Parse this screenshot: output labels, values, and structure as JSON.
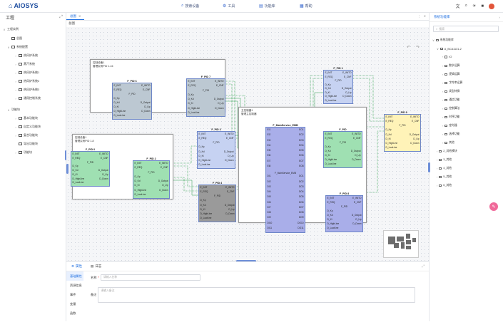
{
  "header": {
    "logo": "AIOSYS",
    "nav": [
      {
        "label": "搜索设备",
        "icon": "search-icon"
      },
      {
        "label": "工具",
        "icon": "tools-icon"
      },
      {
        "label": "功能库",
        "icon": "library-icon"
      },
      {
        "label": "帮助",
        "icon": "help-icon"
      }
    ]
  },
  "left_panel": {
    "title": "工程",
    "tree": [
      {
        "label": "工程实例"
      },
      {
        "label": "总图"
      },
      {
        "label": "系统配置"
      },
      {
        "label": "热风炉系统"
      },
      {
        "label": "蒸汽系统"
      },
      {
        "label": "热风炉系统1"
      },
      {
        "label": "热风炉系统2"
      },
      {
        "label": "热风炉系统3"
      },
      {
        "label": "通用控制系统"
      },
      {
        "label": "功能块"
      },
      {
        "label": "基本功能块"
      },
      {
        "label": "自定义功能块"
      },
      {
        "label": "复合功能块"
      },
      {
        "label": "导出功能块"
      },
      {
        "label": "功能块"
      }
    ]
  },
  "tabs": [
    {
      "label": "总图",
      "active": true
    }
  ],
  "breadcrumb": "总图",
  "canvas": {
    "groups": [
      {
        "title": "控制设备1",
        "subtitle": "管理实例PID 1-16"
      },
      {
        "title": "控制设备1",
        "subtitle": "管理实例PID 1-8"
      },
      {
        "title": "主控制器1",
        "subtitle": "管理主控制器"
      }
    ],
    "blocks": {
      "fpid6": {
        "title": "F_PID 6",
        "left": [
          "E_INIT",
          "E_REQ",
          "",
          "D_Kp",
          "D_Kd",
          "D_Ki",
          "D_HighLine",
          "D_LowLine"
        ],
        "right": [
          "E_INITO",
          "E_CNF",
          "",
          "",
          "D_Output",
          "D_Up",
          "D_Down",
          ""
        ],
        "center": "F_PID"
      },
      "fpid7": {
        "title": "F_PID 7",
        "left": [
          "E_INIT",
          "E_REQ",
          "",
          "D_Kp",
          "D_Kd",
          "D_Ki",
          "D_HighLine",
          "D_LowLine"
        ],
        "right": [
          "E_INITO",
          "E_CNF",
          "",
          "",
          "D_Output",
          "D_Up",
          "D_Down",
          ""
        ],
        "center": "F_PID"
      },
      "fpid1": {
        "title": "F_PID 1",
        "left": [
          "E_INIT",
          "E_REQ",
          "",
          "D_Kp",
          "D_Kd",
          "D_Ki",
          "D_HighLine",
          "D_LowLine"
        ],
        "right": [
          "E_INITO",
          "E_CNF",
          "",
          "",
          "D_Output",
          "D_Up",
          "D_Down",
          ""
        ],
        "center": "F_PID"
      },
      "fpid3": {
        "title": "F_PID 3",
        "left": [
          "E_INIT",
          "E_REQ",
          "",
          "D_Kp",
          "D_Kd",
          "D_Ki",
          "D_HighLine",
          "D_LowLine"
        ],
        "right": [
          "E_INITO",
          "E_CNF",
          "",
          "",
          "D_Output",
          "D_Up",
          "D_Down",
          ""
        ],
        "center": "F_PID"
      },
      "fpid2": {
        "title": "F_PID 2",
        "left": [
          "E_INIT",
          "E_REQ",
          "",
          "D_Kp",
          "D_Kd",
          "D_Ki",
          "D_HighLine",
          "D_LowLine"
        ],
        "right": [
          "E_INITO",
          "E_CNF",
          "",
          "",
          "D_Output",
          "D_Up",
          "D_Down",
          ""
        ],
        "center": "F_PID"
      },
      "fpid0": {
        "title": "F_PID 0",
        "left": [
          "E_INIT",
          "E_REQ",
          "",
          "D_Kp",
          "D_Kd",
          "D_Ki",
          "D_HighLine",
          "D_LowLine"
        ],
        "right": [
          "E_INITO",
          "E_CNF",
          "",
          "",
          "D_Output",
          "D_Up",
          "D_Down",
          ""
        ],
        "center": "F_PID"
      },
      "fpid5": {
        "title": "F_PID",
        "left": [
          "E_INIT",
          "E_REQ",
          "",
          "D_Kp",
          "D_Kd",
          "D_Ki",
          "D_HighLine",
          "D_LowLine"
        ],
        "right": [
          "E_INITO",
          "E_CNF",
          "",
          "",
          "D_Output",
          "D_Up",
          "D_Down",
          ""
        ],
        "center": "F_PID"
      },
      "fpid9": {
        "title": "F_PID 9",
        "left": [
          "E_INIT",
          "E_REQ",
          "",
          "D_Kp",
          "D_Kd",
          "D_Ki",
          "D_HighLine",
          "D_LowLine"
        ],
        "right": [
          "E_INITO",
          "E_CNF",
          "",
          "",
          "D_Output",
          "D_Up",
          "D_Down",
          ""
        ],
        "center": "F_PID"
      },
      "fpid4": {
        "title": "F_PID 4",
        "left": [
          "E_INIT",
          "E_REQ",
          "",
          "D_Kp",
          "D_Kd",
          "D_Ki",
          "D_HighLine",
          "D_LowLine"
        ],
        "right": [
          "E_INITO",
          "E_CNF",
          "",
          "",
          "D_Output",
          "D_Up",
          "D_Down",
          ""
        ],
        "center": "F_PID"
      },
      "fpid8": {
        "title": "F_PID 8",
        "left": [
          "E_INIT",
          "E_REQ",
          "",
          "D_Kp",
          "D_Kd",
          "D_Ki",
          "D_HighLine",
          "D_LowLine"
        ],
        "right": [
          "E_INITO",
          "E_CNF",
          "",
          "",
          "D_Output",
          "D_Up",
          "D_Down",
          ""
        ],
        "center": "F_PID"
      },
      "main": {
        "title": "F_MainService_EMB",
        "center": "F_MainService_EMB",
        "left": [
          "EI1",
          "EI2",
          "EI3",
          "EI4",
          "EI5",
          "EI6",
          "EI7",
          "EI8",
          "",
          "DI1",
          "DI2",
          "DI3",
          "DI4",
          "DI5",
          "DI6",
          "DI7",
          "DI8",
          "DI9",
          "DI10",
          "DI11"
        ],
        "right": [
          "EO1",
          "EO2",
          "EO3",
          "EO4",
          "EO5",
          "EO6",
          "EO7",
          "EO8",
          "",
          "DO1",
          "DO2",
          "DO3",
          "DO4",
          "DO5",
          "DO6",
          "DO7",
          "DO8",
          "DO9",
          "DO10",
          "DO11"
        ]
      }
    }
  },
  "bottom": {
    "tabs": [
      {
        "label": "属性"
      },
      {
        "label": "日志"
      }
    ],
    "side": [
      "基础属性",
      "资源信息",
      "事件",
      "变量",
      "函数"
    ],
    "fields": [
      {
        "label": "名称",
        "placeholder": "请输入名称"
      },
      {
        "label": "备注",
        "placeholder": "请输入备注"
      }
    ]
  },
  "right_panel": {
    "title": "系统功能库",
    "search_placeholder": "搜索",
    "tree": [
      "系统功能库",
      "A_BCA1131-2",
      "IO",
      "数学运算",
      "逻辑运算",
      "字符串运算",
      "类型转换",
      "通信功能",
      "控制算法",
      "时序功能",
      "定时器",
      "选择功能",
      "其他",
      "2_其他模块",
      "3_其他",
      "4_其他",
      "5_其他",
      "6_其他"
    ]
  },
  "colors": {
    "accent": "#1f6fe0",
    "block_blue": "#c6d2f2",
    "block_green": "#9fe0b2",
    "block_steel": "#bcc8d2",
    "block_gray": "#9a9a9a",
    "block_purple": "#a9aee9",
    "block_yellow": "#fff3b8",
    "wire_green": "#2f9e4f"
  }
}
